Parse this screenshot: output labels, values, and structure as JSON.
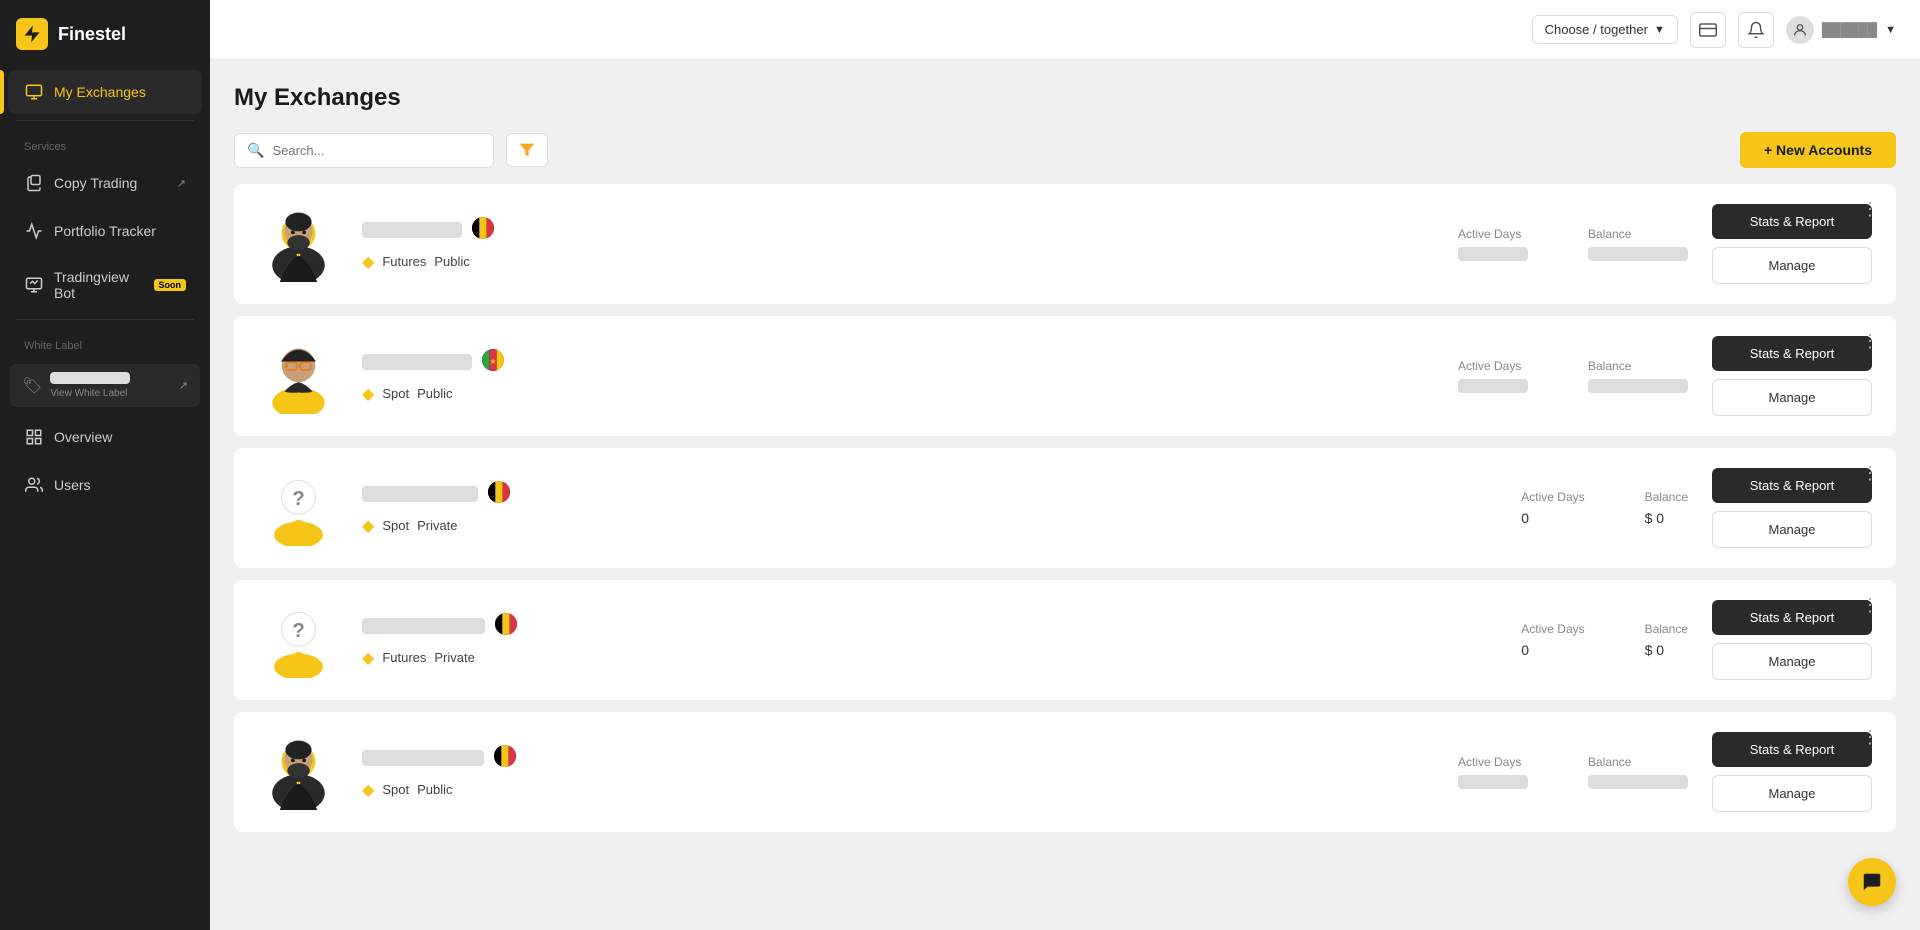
{
  "app": {
    "name": "Finestel"
  },
  "sidebar": {
    "active": "my-exchanges",
    "nav": [
      {
        "id": "my-exchanges",
        "label": "My Exchanges",
        "icon": "exchange"
      },
      {
        "id": "copy-trading",
        "label": "Copy Trading",
        "icon": "copy",
        "external": true
      },
      {
        "id": "portfolio-tracker",
        "label": "Portfolio Tracker",
        "icon": "chart"
      },
      {
        "id": "tradingview-bot",
        "label": "Tradingview Bot",
        "icon": "tv",
        "badge": "Soon"
      }
    ],
    "sections": {
      "services": "Services",
      "white_label": "White Label"
    },
    "white_label": {
      "name": "Blurred Name",
      "sub": "View White Label"
    },
    "menu2": [
      {
        "id": "overview",
        "label": "Overview",
        "icon": "grid"
      },
      {
        "id": "users",
        "label": "Users",
        "icon": "users"
      }
    ]
  },
  "header": {
    "dropdown_label": "Choose / together",
    "new_accounts_label": "+ New Accounts",
    "search_placeholder": "Search..."
  },
  "page": {
    "title": "My Exchanges"
  },
  "toolbar": {
    "filter_title": "Filter"
  },
  "exchanges": [
    {
      "id": 1,
      "name_blurred": true,
      "flag": "be",
      "trade_type": "Futures",
      "visibility": "Public",
      "active_days_label": "Active Days",
      "active_days": "███",
      "balance_label": "Balance",
      "balance": "$ ████████",
      "avatar_type": "bearded"
    },
    {
      "id": 2,
      "name_blurred": true,
      "flag": "cm",
      "trade_type": "Spot",
      "visibility": "Public",
      "active_days_label": "Active Days",
      "active_days": "███",
      "balance_label": "Balance",
      "balance": "$ ████████",
      "avatar_type": "glasses"
    },
    {
      "id": 3,
      "name_blurred": true,
      "flag": "be",
      "trade_type": "Spot",
      "visibility": "Private",
      "active_days_label": "Active Days",
      "active_days": "0",
      "balance_label": "Balance",
      "balance": "$ 0",
      "avatar_type": "unknown"
    },
    {
      "id": 4,
      "name_blurred": true,
      "flag": "be",
      "trade_type": "Futures",
      "visibility": "Private",
      "active_days_label": "Active Days",
      "active_days": "0",
      "balance_label": "Balance",
      "balance": "$ 0",
      "avatar_type": "unknown"
    },
    {
      "id": 5,
      "name_blurred": true,
      "flag": "be",
      "trade_type": "Spot",
      "visibility": "Public",
      "active_days_label": "Active Days",
      "active_days": "███",
      "balance_label": "Balance",
      "balance": "$ ████████",
      "avatar_type": "bearded2"
    }
  ],
  "buttons": {
    "stats_label": "Stats & Report",
    "manage_label": "Manage"
  }
}
